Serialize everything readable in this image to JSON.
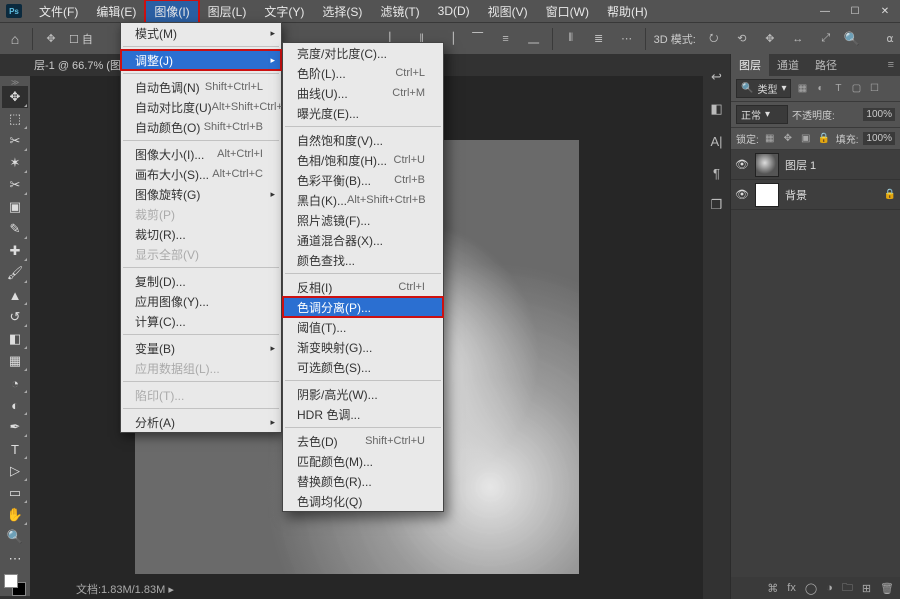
{
  "menubar": {
    "items": [
      "文件(F)",
      "编辑(E)",
      "图像(I)",
      "图层(L)",
      "文字(Y)",
      "选择(S)",
      "滤镜(T)",
      "3D(D)",
      "视图(V)",
      "窗口(W)",
      "帮助(H)"
    ],
    "open_index": 2
  },
  "optbar": {
    "auto_label": "自",
    "mode3d_label": "3D 模式:"
  },
  "doctab": {
    "label": "层-1 @ 66.7% (图"
  },
  "dd1": {
    "mode": "模式(M)",
    "adjust": "调整(J)",
    "auto_tone": "自动色调(N)",
    "auto_tone_sc": "Shift+Ctrl+L",
    "auto_contrast": "自动对比度(U)",
    "auto_contrast_sc": "Alt+Shift+Ctrl+L",
    "auto_color": "自动颜色(O)",
    "auto_color_sc": "Shift+Ctrl+B",
    "image_size": "图像大小(I)...",
    "image_size_sc": "Alt+Ctrl+I",
    "canvas_size": "画布大小(S)...",
    "canvas_size_sc": "Alt+Ctrl+C",
    "rotate": "图像旋转(G)",
    "crop": "裁剪(P)",
    "trim": "裁切(R)...",
    "reveal": "显示全部(V)",
    "duplicate": "复制(D)...",
    "apply_image": "应用图像(Y)...",
    "calc": "计算(C)...",
    "variables": "变量(B)",
    "datasets": "应用数据组(L)...",
    "trap": "陷印(T)...",
    "analysis": "分析(A)"
  },
  "dd2": {
    "bc": "亮度/对比度(C)...",
    "levels": "色阶(L)...",
    "levels_sc": "Ctrl+L",
    "curves": "曲线(U)...",
    "curves_sc": "Ctrl+M",
    "exposure": "曝光度(E)...",
    "vibrance": "自然饱和度(V)...",
    "hsl": "色相/饱和度(H)...",
    "hsl_sc": "Ctrl+U",
    "colorbal": "色彩平衡(B)...",
    "colorbal_sc": "Ctrl+B",
    "bw": "黑白(K)...",
    "bw_sc": "Alt+Shift+Ctrl+B",
    "photofilter": "照片滤镜(F)...",
    "chmixer": "通道混合器(X)...",
    "colorlookup": "颜色查找...",
    "invert": "反相(I)",
    "invert_sc": "Ctrl+I",
    "posterize": "色调分离(P)...",
    "threshold": "阈值(T)...",
    "gradmap": "渐变映射(G)...",
    "selective": "可选颜色(S)...",
    "shadows": "阴影/高光(W)...",
    "hdr": "HDR 色调...",
    "desat": "去色(D)",
    "desat_sc": "Shift+Ctrl+U",
    "matchcolor": "匹配颜色(M)...",
    "replacecolor": "替换颜色(R)...",
    "equalize": "色调均化(Q)"
  },
  "panel": {
    "tabs": [
      "图层",
      "通道",
      "路径"
    ],
    "kind_label": "类型",
    "blend_label": "正常",
    "opacity_label": "不透明度:",
    "opacity_value": "100%",
    "lock_label": "锁定:",
    "fill_label": "填充:",
    "fill_value": "100%",
    "layers": [
      {
        "name": "图层 1"
      },
      {
        "name": "背景"
      }
    ]
  },
  "status": {
    "text": "文档:1.83M/1.83M"
  }
}
